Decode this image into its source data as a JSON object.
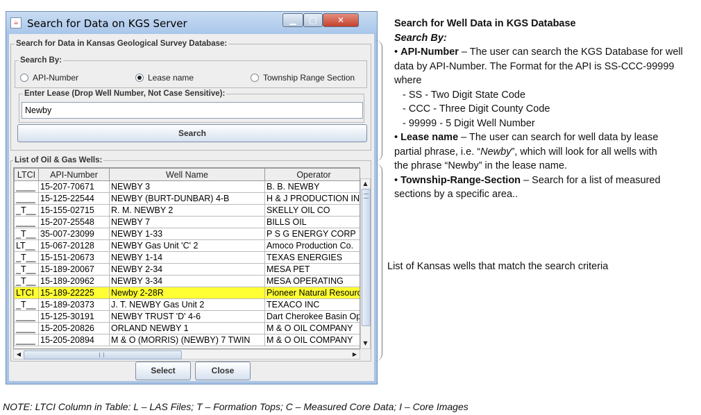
{
  "window": {
    "title": "Search for Data on KGS Server",
    "app_icon": "java-cup-icon",
    "minimize_icon": "minimize-icon",
    "maximize_icon": "maximize-icon",
    "close_icon": "close-icon"
  },
  "search_panel": {
    "label": "Search for Data in Kansas Geological Survey Database:",
    "search_by_label": "Search By:",
    "options": [
      "API-Number",
      "Lease name",
      "Township Range Section"
    ],
    "selected": "Lease name",
    "lease_label": "Enter Lease (Drop Well Number, Not Case Sensitive):",
    "lease_value": "Newby",
    "search_button": "Search"
  },
  "wells": {
    "label": "List of Oil & Gas Wells:",
    "columns": [
      "LTCI",
      "API-Number",
      "Well Name",
      "Operator"
    ],
    "rows": [
      [
        "____",
        "15-207-70671",
        "NEWBY 3",
        "B. B. NEWBY"
      ],
      [
        "____",
        "15-125-22544",
        "NEWBY (BURT-DUNBAR) 4-B",
        "H & J PRODUCTION INC"
      ],
      [
        "_T__",
        "15-155-02715",
        "R. M. NEWBY 2",
        "SKELLY OIL CO"
      ],
      [
        "____",
        "15-207-25548",
        "NEWBY 7",
        "BILLS OIL"
      ],
      [
        "_T__",
        "35-007-23099",
        "NEWBY 1-33",
        "P S G ENERGY CORP"
      ],
      [
        "LT__",
        "15-067-20128",
        "NEWBY Gas Unit 'C' 2",
        "Amoco Production Co."
      ],
      [
        "_T__",
        "15-151-20673",
        "NEWBY 1-14",
        "TEXAS ENERGIES"
      ],
      [
        "_T__",
        "15-189-20067",
        "NEWBY 2-34",
        "MESA PET"
      ],
      [
        "_T__",
        "15-189-20962",
        "NEWBY 3-34",
        "MESA OPERATING"
      ],
      [
        "LTCI",
        "15-189-22225",
        "Newby 2-28R",
        "Pioneer Natural Resources"
      ],
      [
        "_T__",
        "15-189-20373",
        "J. T. NEWBY Gas Unit 2",
        "TEXACO INC"
      ],
      [
        "____",
        "15-125-30191",
        "NEWBY TRUST 'D' 4-6",
        "Dart Cherokee Basin Operating"
      ],
      [
        "____",
        "15-205-20826",
        "ORLAND NEWBY 1",
        "M & O OIL COMPANY"
      ],
      [
        "____",
        "15-205-20894",
        "M & O (MORRIS) (NEWBY) 7 TWIN",
        "M & O OIL COMPANY"
      ]
    ],
    "selected_row": 9,
    "scroll_up_icon": "arrow-up-icon",
    "scroll_down_icon": "arrow-down-icon",
    "scroll_left_icon": "arrow-left-icon",
    "scroll_right_icon": "arrow-right-icon"
  },
  "buttons": {
    "select": "Select",
    "close": "Close"
  },
  "notes": {
    "heading": "Search for Well Data in KGS Database",
    "search_by": "Search By:",
    "api_term": "API-Number",
    "api_text_1": " – The user can search the KGS Database for well",
    "api_text_2": "data by API-Number.  The Format for the API is SS-CCC-99999",
    "api_text_3": "where",
    "api_items": [
      "- SS - Two Digit State Code",
      "- CCC - Three Digit County Code",
      "- 99999 - 5 Digit Well Number"
    ],
    "lease_term": "Lease name",
    "lease_text_1": " – The user can search for well data by lease",
    "lease_text_2a": "partial phrase, i.e. “",
    "lease_text_2b": "Newby",
    "lease_text_2c": "”, which will look for all wells with",
    "lease_text_3": "the phrase “Newby” in the lease name.",
    "trs_term": "Township-Range-Section",
    "trs_text_1": " – Search for a list of measured",
    "trs_text_2": "sections by a specific area..",
    "list_note": "List of Kansas wells that match the search criteria",
    "footer": "NOTE: LTCI Column in Table:  L – LAS Files;  T – Formation Tops;  C – Measured Core Data;  I – Core Images"
  }
}
